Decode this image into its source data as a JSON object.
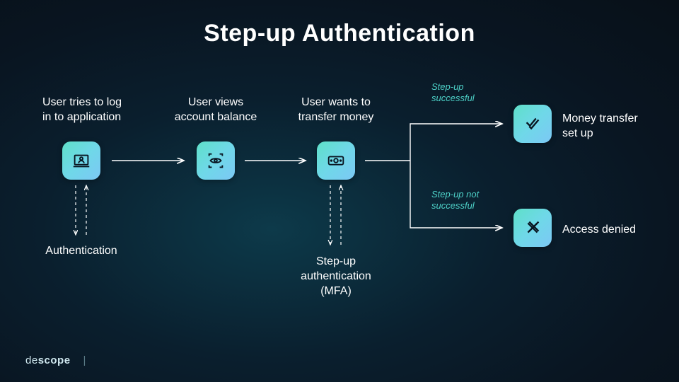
{
  "title": "Step-up Authentication",
  "nodes": {
    "login": {
      "label": "User tries to log\nin to application",
      "icon": "laptop-user-icon",
      "below": "Authentication"
    },
    "balance": {
      "label": "User views\naccount balance",
      "icon": "eye-scan-icon"
    },
    "transfer": {
      "label": "User wants to\ntransfer money",
      "icon": "money-icon",
      "below": "Step-up\nauthentication\n(MFA)"
    }
  },
  "branches": {
    "success": {
      "label": "Step-up\nsuccessful",
      "outcome": "Money transfer\nset up",
      "icon": "check-icon"
    },
    "fail": {
      "label": "Step-up not\nsuccessful",
      "outcome": "Access denied",
      "icon": "cross-icon"
    }
  },
  "logo": {
    "thin": "de",
    "bold": "scope"
  }
}
